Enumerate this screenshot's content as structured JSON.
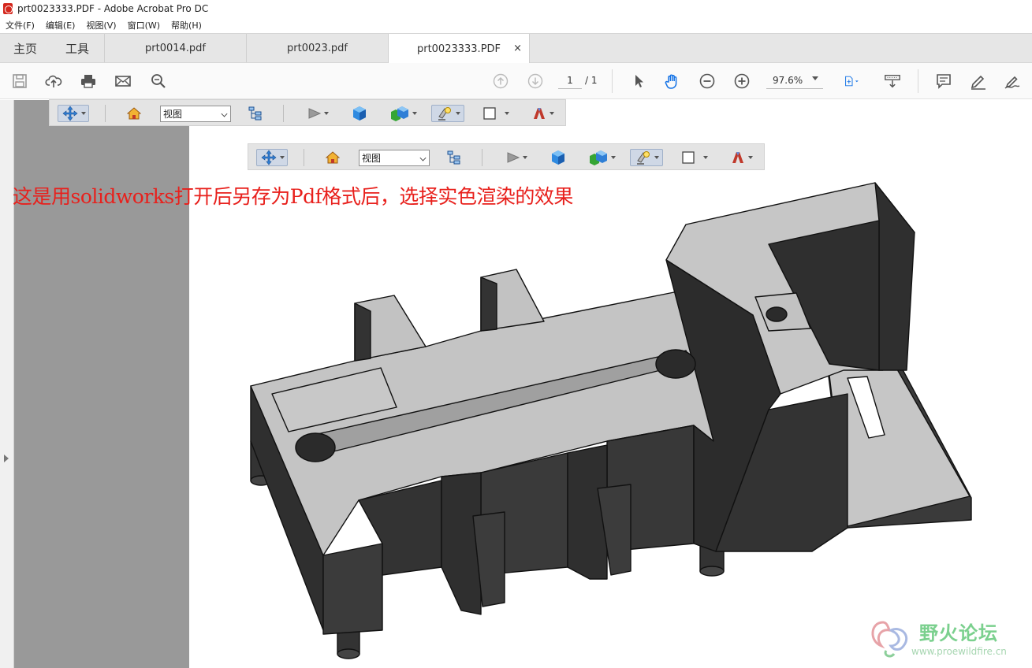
{
  "window": {
    "title": "prt0023333.PDF - Adobe Acrobat Pro DC"
  },
  "menu": [
    "文件(F)",
    "编辑(E)",
    "视图(V)",
    "窗口(W)",
    "帮助(H)"
  ],
  "tabs": {
    "home": "主页",
    "tools": "工具",
    "documents": [
      {
        "label": "prt0014.pdf",
        "active": false
      },
      {
        "label": "prt0023.pdf",
        "active": false
      },
      {
        "label": "prt0023333.PDF",
        "active": true
      }
    ],
    "close_glyph": "×"
  },
  "toolbar": {
    "current_page": "1",
    "total_pages": "/ 1",
    "zoom": "97.6%",
    "icons": [
      "save-icon",
      "upload-icon",
      "print-icon",
      "email-icon",
      "search-zoom-icon",
      "page-up-icon",
      "page-down-icon",
      "select-arrow-icon",
      "hand-icon",
      "zoom-out-icon",
      "zoom-in-icon",
      "fit-page-icon",
      "read-mode-icon",
      "comment-icon",
      "highlight-pen-icon",
      "sign-icon"
    ]
  },
  "toolbar3d": {
    "view_select": "视图",
    "icons": [
      "rotate-icon",
      "home-view-icon",
      "model-tree-icon",
      "play-animation-icon",
      "projection-icon",
      "render-mode-icon",
      "lighting-icon",
      "background-color-icon",
      "cross-section-icon"
    ]
  },
  "annotation": "这是用solidworks打开后另存为Pdf格式后，选择实色渲染的效果",
  "watermark": {
    "title": "野火论坛",
    "url": "www.proewildfire.cn"
  },
  "colors": {
    "annotation_red": "#e8201c",
    "model_light": "#c4c4c4",
    "model_dark": "#393939",
    "acrobat_blue": "#1473e6",
    "watermark_green": "#7bd08e"
  }
}
